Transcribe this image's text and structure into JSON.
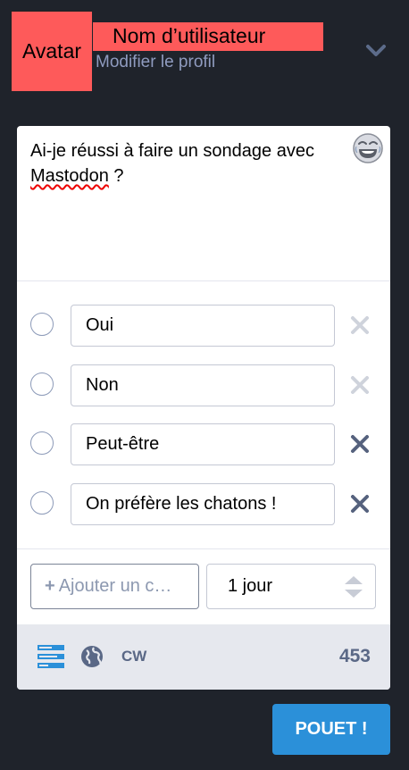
{
  "header": {
    "avatar_label": "Avatar",
    "username": "Nom d’utilisateur",
    "edit_profile": "Modifier le profil",
    "toggle_icon": "chevron-down-icon"
  },
  "compose": {
    "text_before": "Ai-je réussi à faire un sondage avec ",
    "text_misspelled": "Mastodon",
    "text_after": " ?",
    "emoji_icon": "laughing-emoji-icon"
  },
  "poll": {
    "options": [
      {
        "value": "Oui",
        "removable": false
      },
      {
        "value": "Non",
        "removable": false
      },
      {
        "value": "Peut-être",
        "removable": true
      },
      {
        "value": "On préfère les chatons !",
        "removable": true
      }
    ],
    "add_choice_label": "Ajouter un c…",
    "duration": "1 jour"
  },
  "toolbar": {
    "cw_label": "CW",
    "char_counter": "453"
  },
  "submit_label": "POUET !",
  "colors": {
    "accent": "#2b90d9",
    "placeholder_red": "#fe5a5a",
    "background": "#1f232b"
  }
}
